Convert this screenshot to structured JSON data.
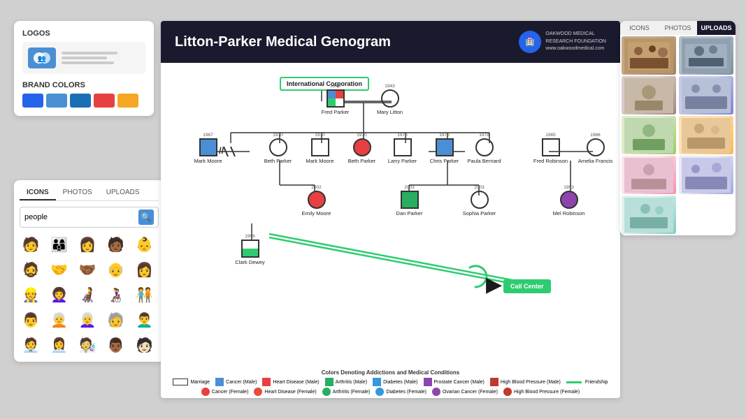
{
  "leftPanel": {
    "logosLabel": "LOGOS",
    "brandColorsLabel": "BRAND COLORS",
    "colors": [
      "#2563eb",
      "#4a8fd4",
      "#1a6eb5",
      "#e84040",
      "#f5a623"
    ]
  },
  "iconsPanel": {
    "tabs": [
      "ICONS",
      "PHOTOS",
      "UPLOADS"
    ],
    "activeTab": "ICONS",
    "searchPlaceholder": "people",
    "searchValue": "people",
    "icons": [
      "🧑",
      "👨‍👩‍👦",
      "👩",
      "🧑🏾",
      "👶",
      "🧔",
      "🤝",
      "🤝",
      "👴",
      "👩",
      "👷",
      "👩‍🦱",
      "🧑‍🦼",
      "👩‍🦽",
      "🧑‍🤝‍🧑",
      "👨",
      "🧑‍🦳",
      "👩‍🦳",
      "🧓",
      "👨‍🦱",
      "🧑‍💼",
      "👩‍💼",
      "🧑‍🔬",
      "👨🏾",
      "🧑🏻"
    ]
  },
  "genogram": {
    "title": "Litton-Parker Medical Genogram",
    "orgName": "OAKWOOD MEDICAL\nRESEARCH FOUNDATION\nwww.oakwoodmedical.com",
    "people": {
      "fredParker": {
        "name": "Fred Parker",
        "year": "1945",
        "shape": "square"
      },
      "maryLitton": {
        "name": "Mary Litton",
        "year": "1943",
        "shape": "circle"
      },
      "markMoore1": {
        "name": "Mark Moore",
        "year": "1967",
        "shape": "square"
      },
      "bethParker": {
        "name": "Beth Parker",
        "year": "1970",
        "shape": "circle"
      },
      "markMoore2": {
        "name": "Mark Moore",
        "year": "1970",
        "shape": "square"
      },
      "bethParker2": {
        "name": "Beth Parker",
        "year": "1970",
        "shape": "circle"
      },
      "larryParker": {
        "name": "Larry Parker",
        "year": "1970",
        "shape": "square"
      },
      "chrisParker": {
        "name": "Chris Parker",
        "year": "1970",
        "shape": "square"
      },
      "paulaBernard": {
        "name": "Paula Bernard",
        "year": "1978",
        "shape": "circle"
      },
      "fredRobinson": {
        "name": "Fred Robinson",
        "year": "1965",
        "shape": "square"
      },
      "ameliaFrancis": {
        "name": "Amelia Francis",
        "year": "1966",
        "shape": "circle"
      },
      "emilyMoore": {
        "name": "Emily Moore",
        "year": "2002",
        "shape": "circle"
      },
      "danParker": {
        "name": "Dan Parker",
        "year": "2003",
        "shape": "square"
      },
      "sophiaParker": {
        "name": "Sophia Parker",
        "year": "2003",
        "shape": "circle"
      },
      "melRobinson": {
        "name": "Mel Robinson",
        "year": "1993",
        "shape": "circle"
      },
      "clarkDewey": {
        "name": "Clark Dewey",
        "year": "1996",
        "shape": "square"
      }
    },
    "labels": {
      "internationalCorp": "International Corporation",
      "callCenter": "Call Center"
    },
    "legend": {
      "title": "Colors Denoting Addictions and Medical Conditions",
      "items": [
        {
          "type": "line",
          "color": "#333",
          "label": "Marriage"
        },
        {
          "type": "box",
          "color": "#4a8fd4",
          "label": "Cancer (Male)"
        },
        {
          "type": "box",
          "color": "#e84040",
          "label": "Heart Disease (Male)"
        },
        {
          "type": "box",
          "color": "#27ae60",
          "label": "Arthritis (Male)"
        },
        {
          "type": "box",
          "color": "#3498db",
          "label": "Diabetes (Male)"
        },
        {
          "type": "box",
          "color": "#8e44ad",
          "label": "Prostate Cancer (Male)"
        },
        {
          "type": "box",
          "color": "#c0392b",
          "label": "High Blood Pressure  (Male)"
        },
        {
          "type": "line",
          "color": "#2ecc71",
          "label": "Friendship"
        },
        {
          "type": "circle",
          "color": "#e84040",
          "label": "Cancer (Female)"
        },
        {
          "type": "circle",
          "color": "#e74c3c",
          "label": "Heart Disease (Female)"
        },
        {
          "type": "circle",
          "color": "#27ae60",
          "label": "Arthritis (Female)"
        },
        {
          "type": "circle",
          "color": "#3498db",
          "label": "Diabetes (Female)"
        },
        {
          "type": "circle",
          "color": "#8e44ad",
          "label": "Ovarian Cancer (Female)"
        },
        {
          "type": "circle",
          "color": "#c0392b",
          "label": "High Blood Pressure (Female)"
        }
      ]
    }
  },
  "rightPanel": {
    "tabs": [
      "ICONS",
      "PHOTOS",
      "UPLOADS"
    ],
    "activeTab": "UPLOADS",
    "photos": 9
  }
}
